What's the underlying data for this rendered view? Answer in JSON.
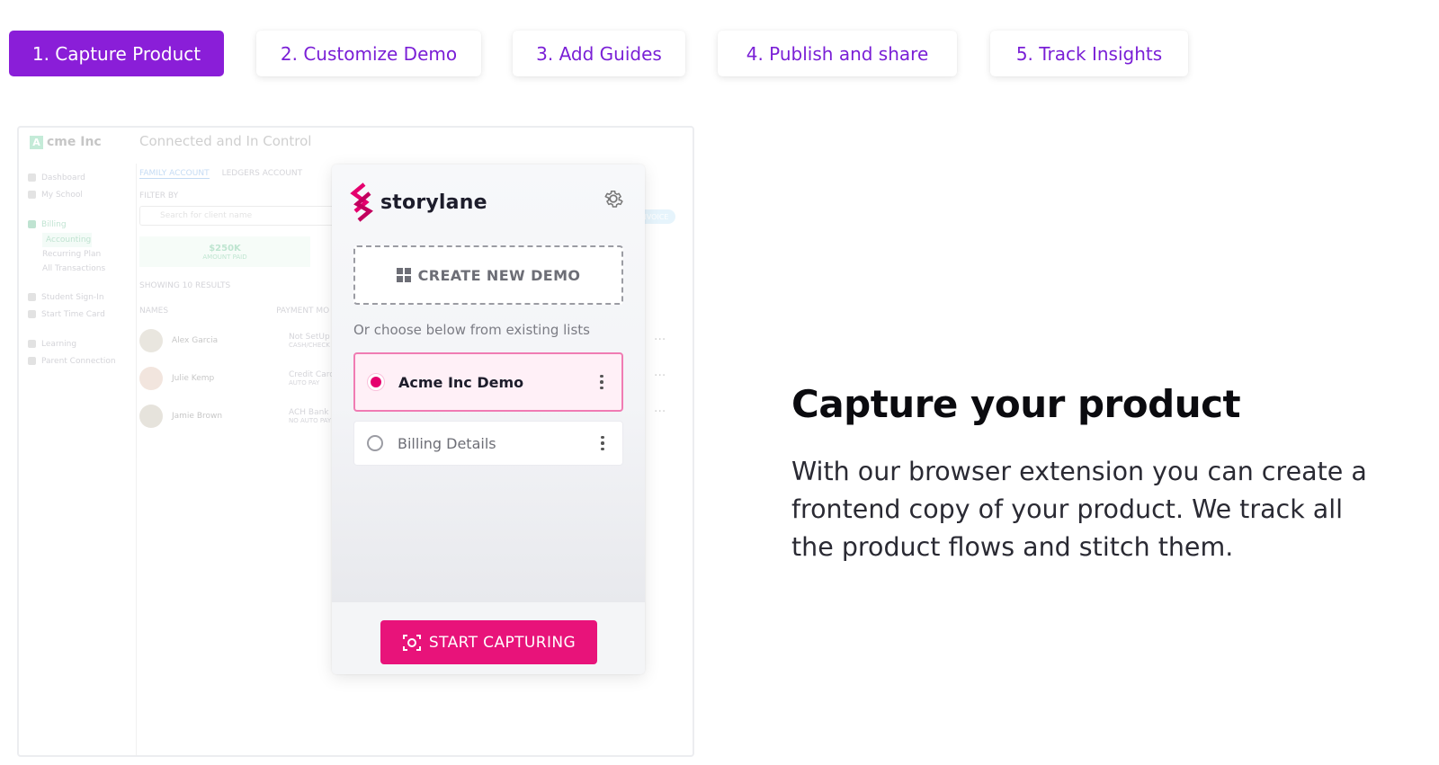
{
  "tabs": [
    {
      "label": "1. Capture Product",
      "active": true
    },
    {
      "label": "2. Customize Demo",
      "active": false
    },
    {
      "label": "3. Add Guides",
      "active": false
    },
    {
      "label": "4. Publish and share",
      "active": false
    },
    {
      "label": "5. Track Insights",
      "active": false
    }
  ],
  "background_app": {
    "logo": "cme Inc",
    "logo_letter": "A",
    "header": "Connected and In Control",
    "sidebar": [
      "Dashboard",
      "My School",
      "Billing",
      "Accounting",
      "Recurring Plan",
      "All Transactions",
      "Student Sign-In",
      "Start Time Card",
      "Learning",
      "Parent Connection"
    ],
    "tabs": [
      "FAMILY ACCOUNT",
      "LEDGERS ACCOUNT"
    ],
    "filter_label": "FILTER BY",
    "search_placeholder": "Search for client name",
    "kpi_value": "$250K",
    "kpi_label": "AMOUNT PAID",
    "results": "SHOWING 10 RESULTS",
    "columns": [
      "NAMES",
      "PAYMENT MO"
    ],
    "rows": [
      {
        "name": "Alex Garcia",
        "payment": "Not SetUp",
        "sub": "CASH/CHECK"
      },
      {
        "name": "Julie Kemp",
        "payment": "Credit Card",
        "sub": "AUTO PAY"
      },
      {
        "name": "Jamie Brown",
        "payment": "ACH Bank",
        "sub": "NO AUTO PAY"
      }
    ],
    "invoice_badge": "INVOICE"
  },
  "extension": {
    "brand": "storylane",
    "brand_color": "#e5006e",
    "settings_icon": "gear-icon",
    "create_label": "CREATE NEW DEMO",
    "choose_label": "Or choose below from existing lists",
    "demos": [
      {
        "name": "Acme Inc Demo",
        "selected": true
      },
      {
        "name": "Billing Details",
        "selected": false
      }
    ],
    "start_label": "START CAPTURING",
    "start_icon": "capture-icon"
  },
  "content": {
    "headline": "Capture your product",
    "description": "With our browser extension you can create a frontend copy of your product. We track all the product flows and stitch them."
  },
  "colors": {
    "accent_purple": "#8a1ed8",
    "tab_text": "#7a1fd6",
    "cta_pink": "#e8137a"
  }
}
